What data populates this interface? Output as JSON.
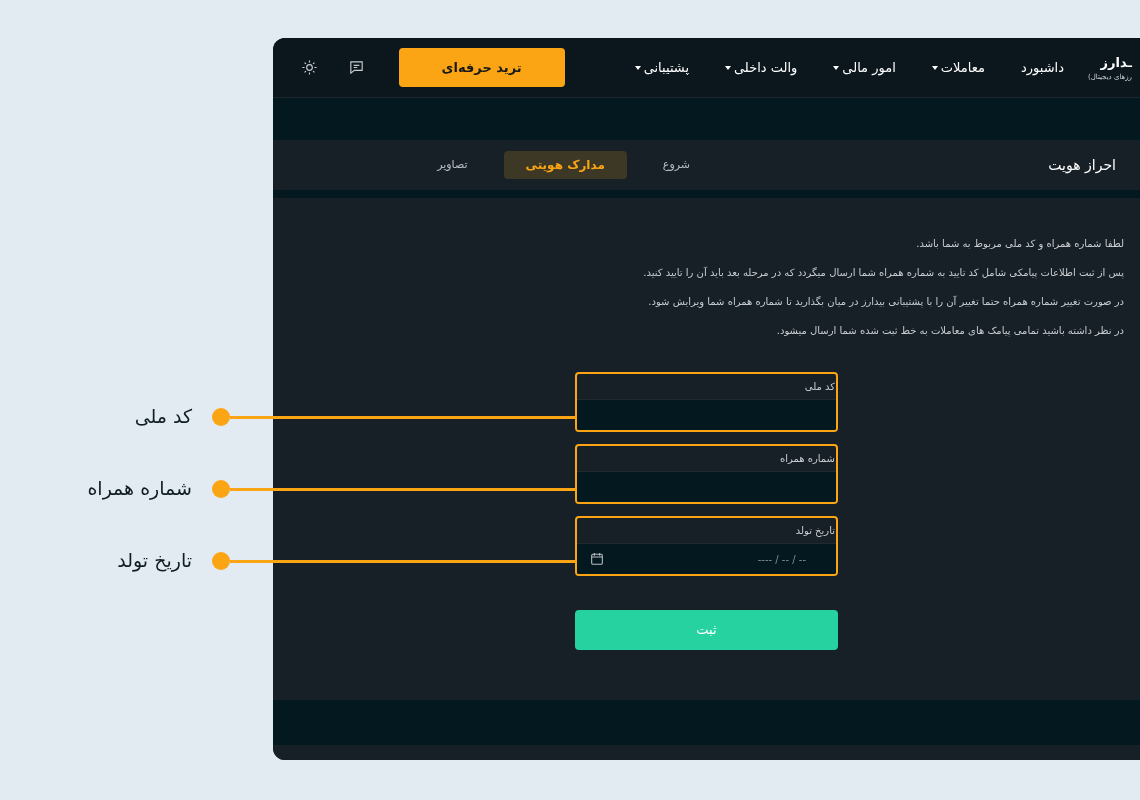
{
  "logo": {
    "name": "ـدارز",
    "tagline": "رزهای دیجیتال)"
  },
  "nav": [
    {
      "label": "داشبورد",
      "dropdown": false
    },
    {
      "label": "معاملات",
      "dropdown": true
    },
    {
      "label": "امور مالی",
      "dropdown": true
    },
    {
      "label": "والت داخلی",
      "dropdown": true
    },
    {
      "label": "پشتیبانی",
      "dropdown": true
    }
  ],
  "trade_button": "ترید حرفه‌ای",
  "page_title": "احراز هویت",
  "steps": [
    {
      "label": "شروع",
      "selected": false
    },
    {
      "label": "مدارک هویتی",
      "selected": true
    },
    {
      "label": "تصاویر",
      "selected": false
    }
  ],
  "instructions": [
    "لطفا شماره همراه و کد ملی مربوط به شما باشد.",
    "پس از ثبت اطلاعات پیامکی شامل کد تایید به شماره همراه شما ارسال میگردد که در مرحله بعد باید آن را تایید کنید.",
    "در صورت تغییر شماره همراه حتما تغییر آن را با پشتیبانی بیدارز در میان بگذارید تا شماره همراه شما ویرایش شود.",
    "در نظر داشته باشید تمامی پیامک های معاملات به خط ثبت شده شما ارسال میشود."
  ],
  "fields": [
    {
      "kind": "text",
      "label": "کد ملی"
    },
    {
      "kind": "text",
      "label": "شماره همراه"
    },
    {
      "kind": "date",
      "label": "تاریخ تولد",
      "placeholder": "---- / -- / --"
    }
  ],
  "submit_button": "ثبت",
  "annotations": [
    "کد ملی",
    "شماره همراه",
    "تاریخ تولد"
  ]
}
